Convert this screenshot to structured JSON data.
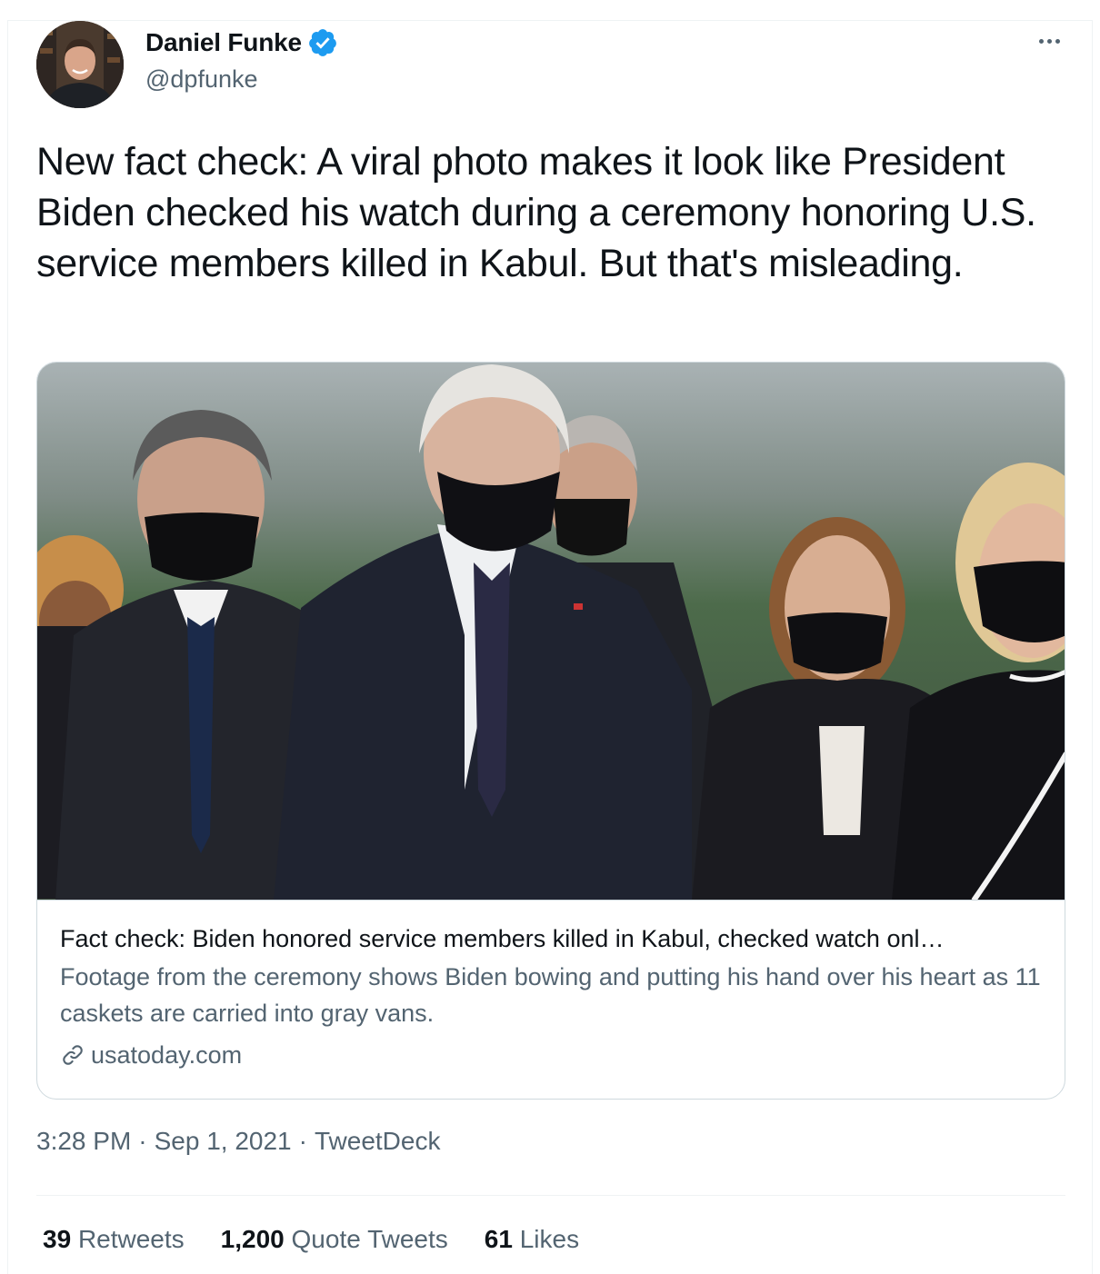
{
  "author": {
    "display_name": "Daniel Funke",
    "handle": "@dpfunke",
    "verified": true
  },
  "tweet": {
    "text": "New fact check: A viral photo makes it look like President Biden checked his watch during a ceremony honoring U.S. service members killed in Kabul. But that's misleading."
  },
  "card": {
    "title": "Fact check: Biden honored service members killed in Kabul, checked watch onl…",
    "description": "Footage from the ceremony shows Biden bowing and putting his hand over his heart as 11 caskets are carried into gray vans.",
    "domain": "usatoday.com"
  },
  "meta": {
    "time": "3:28 PM",
    "separator": "·",
    "date": "Sep 1, 2021",
    "source": "TweetDeck"
  },
  "stats": [
    {
      "count": "39",
      "label": "Retweets"
    },
    {
      "count": "1,200",
      "label": "Quote Tweets"
    },
    {
      "count": "61",
      "label": "Likes"
    }
  ],
  "colors": {
    "verified_blue": "#1d9bf0",
    "secondary_text": "#536471",
    "primary_text": "#0f1419"
  },
  "icons": {
    "verified": "verified-badge-icon",
    "more": "more-dots-icon",
    "link": "link-icon"
  }
}
